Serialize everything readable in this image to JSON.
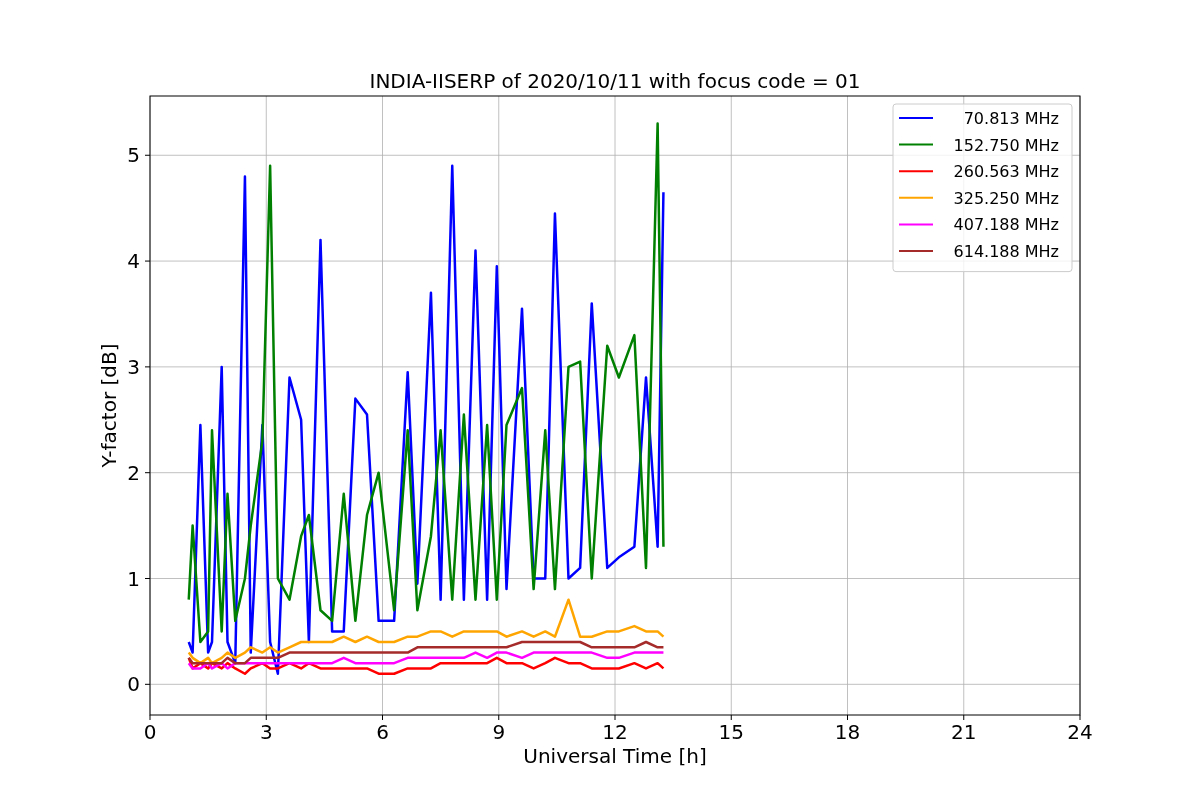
{
  "chart_data": {
    "type": "line",
    "title": "INDIA-IISERP of 2020/10/11 with focus code = 01",
    "xlabel": "Universal Time [h]",
    "ylabel": "Y-factor [dB]",
    "xlim": [
      0,
      24
    ],
    "ylim": [
      -0.29,
      5.56
    ],
    "xticks": [
      0,
      3,
      6,
      9,
      12,
      15,
      18,
      21,
      24
    ],
    "yticks": [
      0,
      1,
      2,
      3,
      4,
      5
    ],
    "grid": true,
    "legend": true,
    "x": [
      1.0,
      1.1,
      1.3,
      1.5,
      1.6,
      1.85,
      2.0,
      2.2,
      2.45,
      2.6,
      2.9,
      3.1,
      3.3,
      3.6,
      3.9,
      4.1,
      4.4,
      4.7,
      5.0,
      5.3,
      5.6,
      5.9,
      6.3,
      6.65,
      6.9,
      7.25,
      7.5,
      7.8,
      8.1,
      8.4,
      8.7,
      8.95,
      9.2,
      9.6,
      9.9,
      10.2,
      10.45,
      10.8,
      11.1,
      11.4,
      11.8,
      12.1,
      12.5,
      12.8,
      13.1,
      13.25
    ],
    "series": [
      {
        "name": "70.813 MHz",
        "color": "#0000ff",
        "values": [
          0.4,
          0.3,
          2.45,
          0.3,
          0.4,
          3.0,
          0.4,
          0.2,
          4.8,
          0.3,
          2.45,
          0.4,
          0.1,
          2.9,
          2.5,
          0.4,
          4.2,
          0.5,
          0.5,
          2.7,
          2.55,
          0.6,
          0.6,
          2.95,
          0.95,
          3.7,
          0.8,
          4.9,
          0.8,
          4.1,
          0.8,
          3.95,
          0.9,
          3.55,
          1.0,
          1.0,
          4.45,
          1.0,
          1.1,
          3.6,
          1.1,
          1.2,
          1.3,
          2.9,
          1.3,
          4.65
        ]
      },
      {
        "name": "152.750 MHz",
        "color": "#008000",
        "values": [
          0.8,
          1.5,
          0.4,
          0.5,
          2.4,
          0.5,
          1.8,
          0.6,
          1.0,
          1.5,
          2.3,
          4.9,
          1.0,
          0.8,
          1.4,
          1.6,
          0.7,
          0.6,
          1.8,
          0.6,
          1.6,
          2.0,
          0.7,
          2.4,
          0.7,
          1.4,
          2.4,
          0.8,
          2.55,
          0.8,
          2.45,
          0.8,
          2.45,
          2.8,
          0.9,
          2.4,
          0.9,
          3.0,
          3.05,
          1.0,
          3.2,
          2.9,
          3.3,
          1.1,
          5.3,
          1.3
        ]
      },
      {
        "name": "260.563 MHz",
        "color": "#ff0000",
        "values": [
          0.25,
          0.15,
          0.2,
          0.15,
          0.2,
          0.15,
          0.2,
          0.15,
          0.1,
          0.15,
          0.2,
          0.15,
          0.15,
          0.2,
          0.15,
          0.2,
          0.15,
          0.15,
          0.15,
          0.15,
          0.15,
          0.1,
          0.1,
          0.15,
          0.15,
          0.15,
          0.2,
          0.2,
          0.2,
          0.2,
          0.2,
          0.25,
          0.2,
          0.2,
          0.15,
          0.2,
          0.25,
          0.2,
          0.2,
          0.15,
          0.15,
          0.15,
          0.2,
          0.15,
          0.2,
          0.15
        ]
      },
      {
        "name": "325.250 MHz",
        "color": "#ffa500",
        "values": [
          0.3,
          0.25,
          0.2,
          0.25,
          0.2,
          0.25,
          0.3,
          0.25,
          0.3,
          0.35,
          0.3,
          0.35,
          0.3,
          0.35,
          0.4,
          0.4,
          0.4,
          0.4,
          0.45,
          0.4,
          0.45,
          0.4,
          0.4,
          0.45,
          0.45,
          0.5,
          0.5,
          0.45,
          0.5,
          0.5,
          0.5,
          0.5,
          0.45,
          0.5,
          0.45,
          0.5,
          0.45,
          0.8,
          0.45,
          0.45,
          0.5,
          0.5,
          0.55,
          0.5,
          0.5,
          0.45
        ]
      },
      {
        "name": "407.188 MHz",
        "color": "#ff00ff",
        "values": [
          0.2,
          0.15,
          0.15,
          0.2,
          0.15,
          0.2,
          0.15,
          0.2,
          0.2,
          0.2,
          0.2,
          0.2,
          0.2,
          0.2,
          0.2,
          0.2,
          0.2,
          0.2,
          0.25,
          0.2,
          0.2,
          0.2,
          0.2,
          0.25,
          0.25,
          0.25,
          0.25,
          0.25,
          0.25,
          0.3,
          0.25,
          0.3,
          0.3,
          0.25,
          0.3,
          0.3,
          0.3,
          0.3,
          0.3,
          0.3,
          0.25,
          0.25,
          0.3,
          0.3,
          0.3,
          0.3
        ]
      },
      {
        "name": "614.188 MHz",
        "color": "#a52a2a",
        "values": [
          0.25,
          0.2,
          0.2,
          0.2,
          0.2,
          0.2,
          0.25,
          0.2,
          0.2,
          0.25,
          0.25,
          0.25,
          0.25,
          0.3,
          0.3,
          0.3,
          0.3,
          0.3,
          0.3,
          0.3,
          0.3,
          0.3,
          0.3,
          0.3,
          0.35,
          0.35,
          0.35,
          0.35,
          0.35,
          0.35,
          0.35,
          0.35,
          0.35,
          0.4,
          0.4,
          0.4,
          0.4,
          0.4,
          0.4,
          0.35,
          0.35,
          0.35,
          0.35,
          0.4,
          0.35,
          0.35
        ]
      }
    ]
  }
}
